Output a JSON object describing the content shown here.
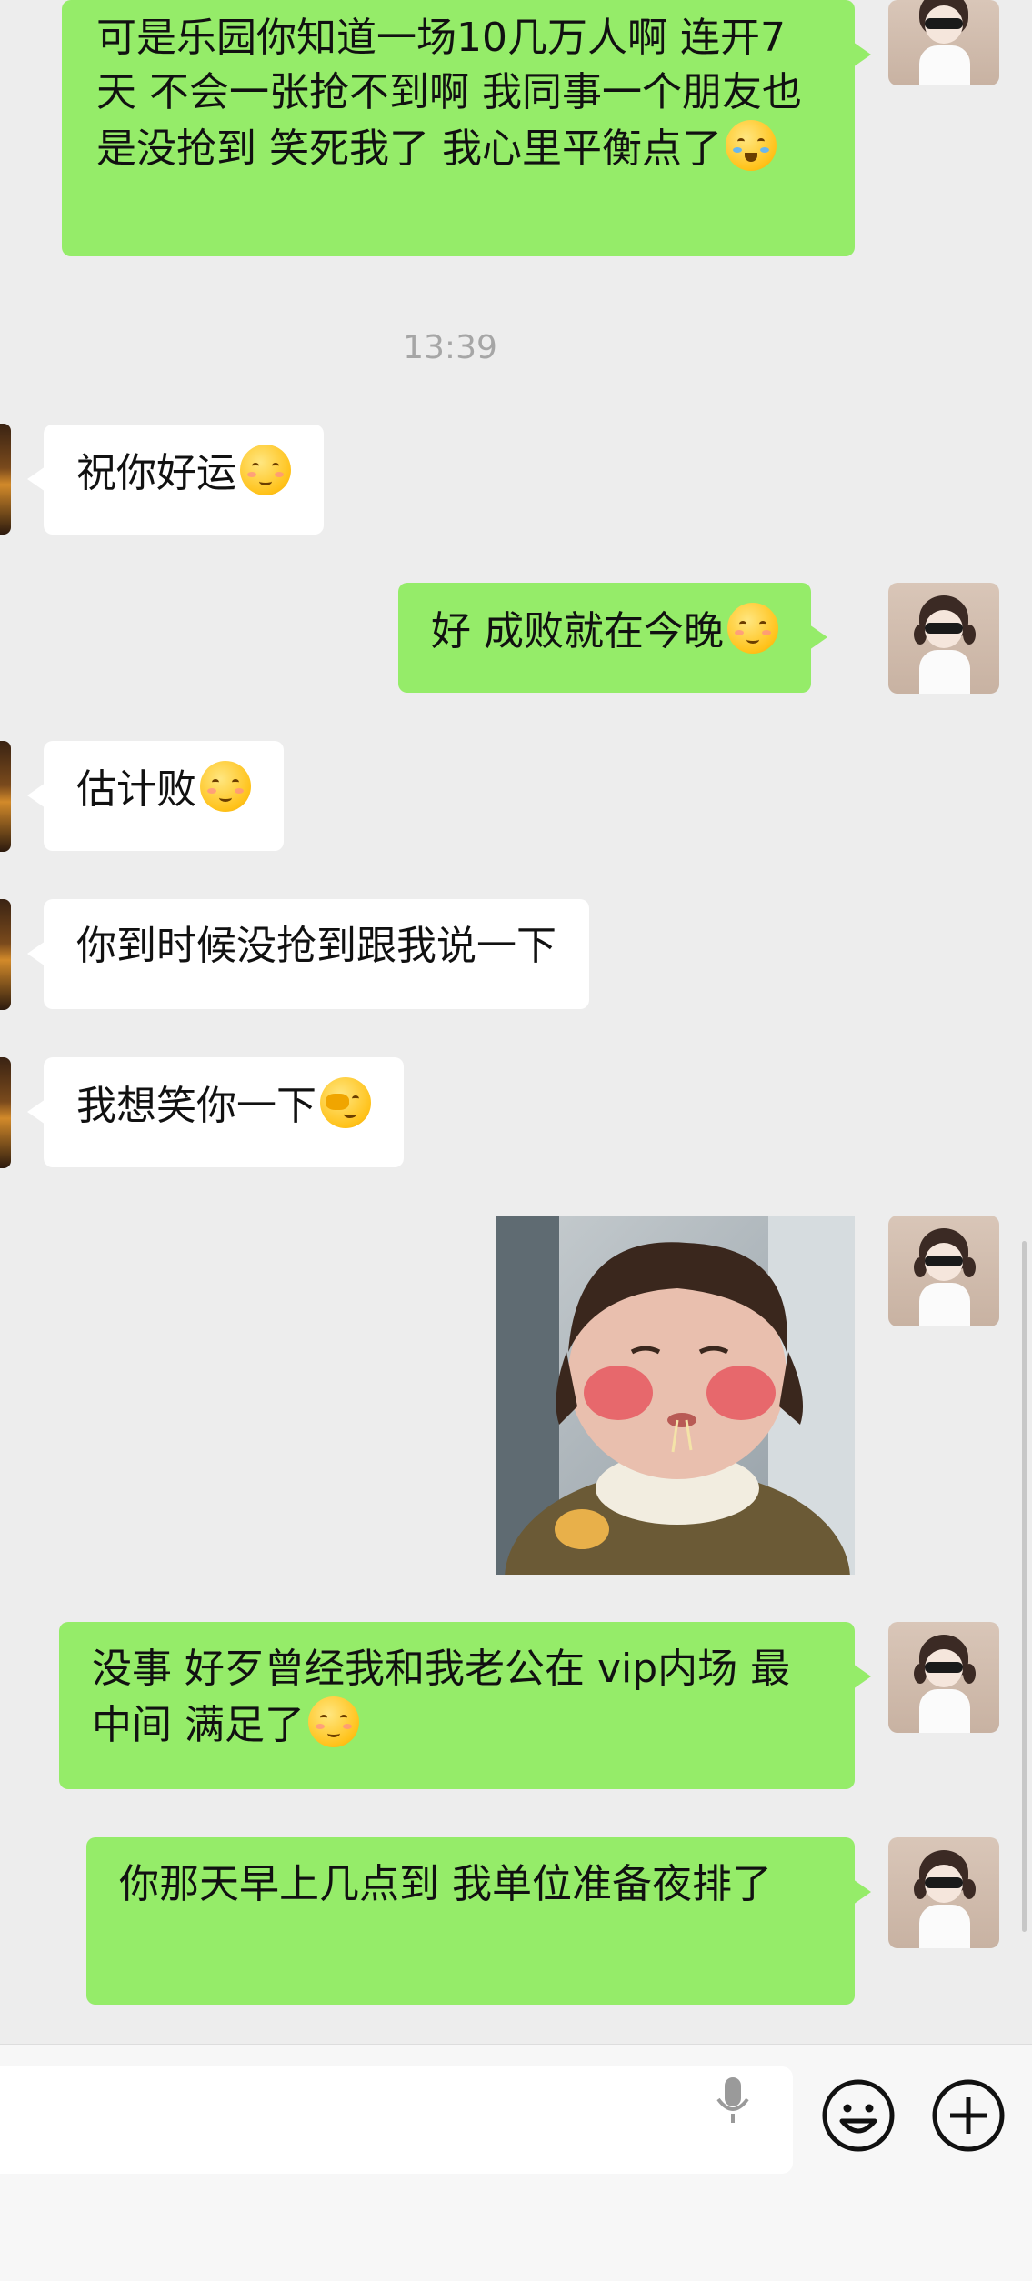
{
  "messages": [
    {
      "id": "m1",
      "side": "out",
      "text": "可是乐园你知道一场10几万人啊  连开7天 不会一张抢不到啊 我同事一个朋友也是没抢到 笑死我了 我心里平衡点了",
      "emoji": "crying-laughing-emoji"
    },
    {
      "id": "m2",
      "side": "in",
      "text": "祝你好运",
      "emoji": "shy-smile-emoji"
    },
    {
      "id": "m3",
      "side": "out",
      "text": "好 成败就在今晚",
      "emoji": "shy-smile-emoji"
    },
    {
      "id": "m4",
      "side": "in",
      "text": "估计败",
      "emoji": "shy-smile-emoji"
    },
    {
      "id": "m5",
      "side": "in",
      "text": "你到时候没抢到跟我说一下",
      "emoji": ""
    },
    {
      "id": "m6",
      "side": "in",
      "text": "我想笑你一下",
      "emoji": "facepalm-peek-emoji"
    },
    {
      "id": "m7",
      "side": "out",
      "type": "sticker",
      "sticker": "toddler-blushing-eating-sticker"
    },
    {
      "id": "m8",
      "side": "out",
      "text": "没事 好歹曾经我和我老公在 vip内场 最中间  满足了",
      "emoji": "shy-smile-emoji"
    },
    {
      "id": "m9",
      "side": "out",
      "text": "你那天早上几点到 我单位准备夜排了",
      "emoji": ""
    }
  ],
  "timestamp": "13:39",
  "bottom_bar": {
    "icons": [
      "microphone-icon",
      "emoji-icon",
      "plus-icon"
    ]
  },
  "colors": {
    "outgoing_bubble": "#95ec69",
    "incoming_bubble": "#ffffff",
    "background": "#ededed"
  }
}
